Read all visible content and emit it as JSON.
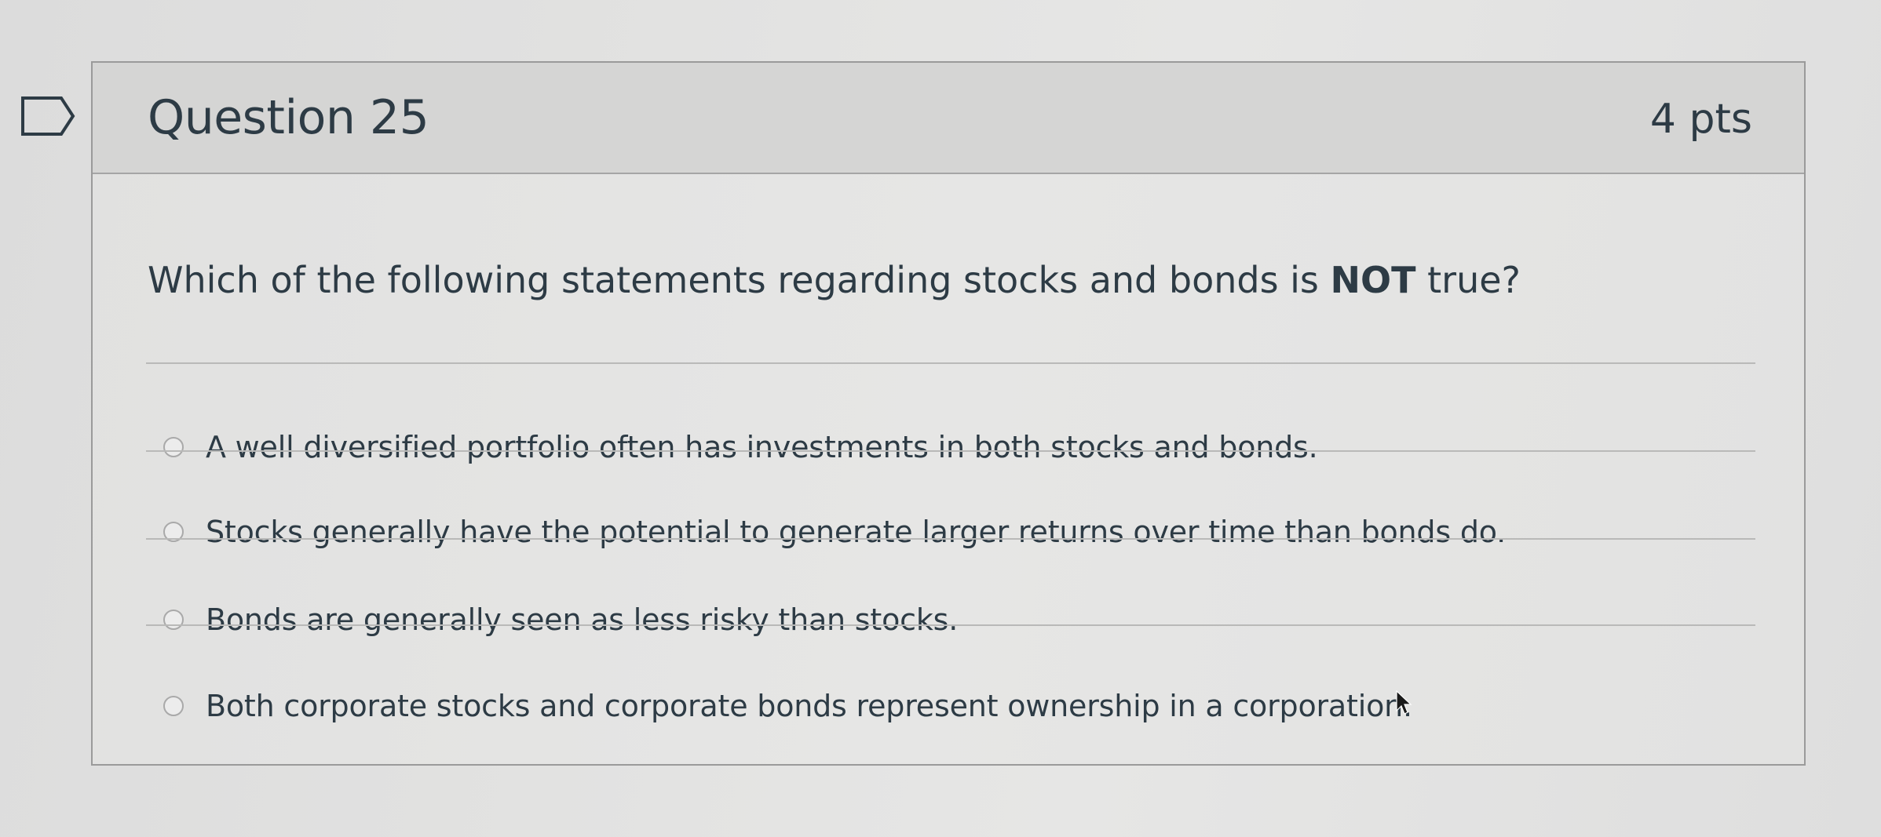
{
  "question": {
    "title": "Question 25",
    "points": "4 pts",
    "text_prefix": "Which of the following statements regarding stocks and bonds is ",
    "text_emphasis": "NOT",
    "text_suffix": " true?",
    "answers": [
      "A well diversified portfolio often has investments in both stocks and bonds.",
      "Stocks generally have the potential to generate larger returns over time than bonds do.",
      "Bonds are generally seen as less risky than stocks.",
      "Both corporate stocks and corporate bonds represent ownership in a corporation."
    ]
  },
  "icons": {
    "flag": "flag-outline-icon",
    "cursor": "mouse-pointer-icon"
  }
}
